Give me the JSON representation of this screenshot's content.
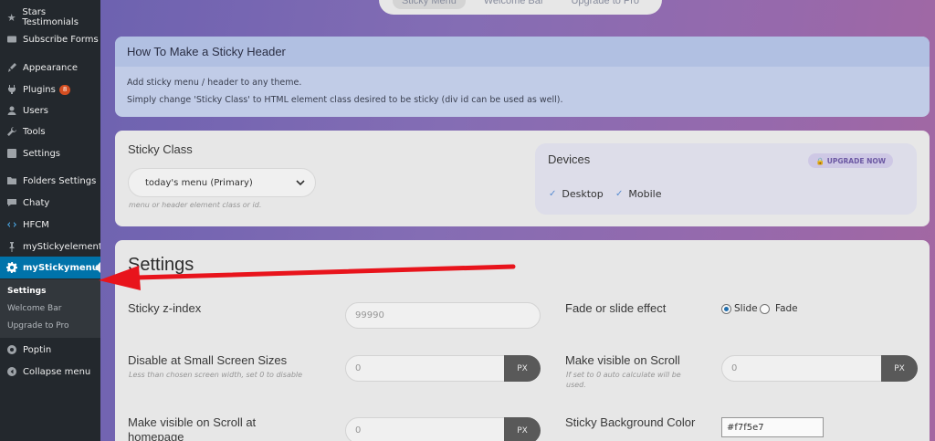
{
  "sidebar": {
    "items": [
      {
        "label": "Stars Testimonials",
        "icon": "star-icon"
      },
      {
        "label": "Subscribe Forms",
        "icon": "envelope-icon"
      },
      {
        "label": "Appearance",
        "icon": "brush-icon"
      },
      {
        "label": "Plugins",
        "icon": "plug-icon",
        "badge": "8"
      },
      {
        "label": "Users",
        "icon": "user-icon"
      },
      {
        "label": "Tools",
        "icon": "wrench-icon"
      },
      {
        "label": "Settings",
        "icon": "settings-icon"
      },
      {
        "label": "Folders Settings",
        "icon": "folder-icon"
      },
      {
        "label": "Chaty",
        "icon": "chat-icon"
      },
      {
        "label": "HFCM",
        "icon": "code-icon"
      },
      {
        "label": "myStickyelements",
        "icon": "pin-icon"
      },
      {
        "label": "myStickymenu",
        "icon": "gear-icon"
      },
      {
        "label": "Poptin",
        "icon": "poptin-icon"
      },
      {
        "label": "Collapse menu",
        "icon": "collapse-icon"
      }
    ],
    "submenu": [
      "Settings",
      "Welcome Bar",
      "Upgrade to Pro"
    ]
  },
  "tabs": [
    "Sticky Menu",
    "Welcome Bar",
    "Upgrade to Pro"
  ],
  "howto": {
    "title": "How To Make a Sticky Header",
    "line1": "Add sticky menu / header to any theme.",
    "line2": "Simply change 'Sticky Class' to HTML element class desired to be sticky (div id can be used as well)."
  },
  "sticky_class": {
    "label": "Sticky Class",
    "value": "today's menu (Primary)",
    "hint": "menu or header element class or id."
  },
  "devices": {
    "label": "Devices",
    "upgrade": "UPGRADE NOW",
    "options": [
      "Desktop",
      "Mobile"
    ]
  },
  "settings": {
    "title": "Settings",
    "z_index_label": "Sticky z-index",
    "z_index_value": "99990",
    "effect_label": "Fade or slide effect",
    "effect_slide": "Slide",
    "effect_fade": "Fade",
    "disable_label": "Disable at Small Screen Sizes",
    "disable_hint": "Less than chosen screen width, set 0 to disable",
    "disable_value": "0",
    "px": "PX",
    "scroll_label": "Make visible on Scroll",
    "scroll_hint": "If set to 0 auto calculate will be used.",
    "scroll_value": "0",
    "scroll_home_label": "Make visible on Scroll at homepage",
    "scroll_home_value": "0",
    "bg_label": "Sticky Background Color",
    "bg_value": "#f7f5e7"
  },
  "colors": {
    "wp_active": "#0073aa",
    "arrow": "#e8141c"
  }
}
